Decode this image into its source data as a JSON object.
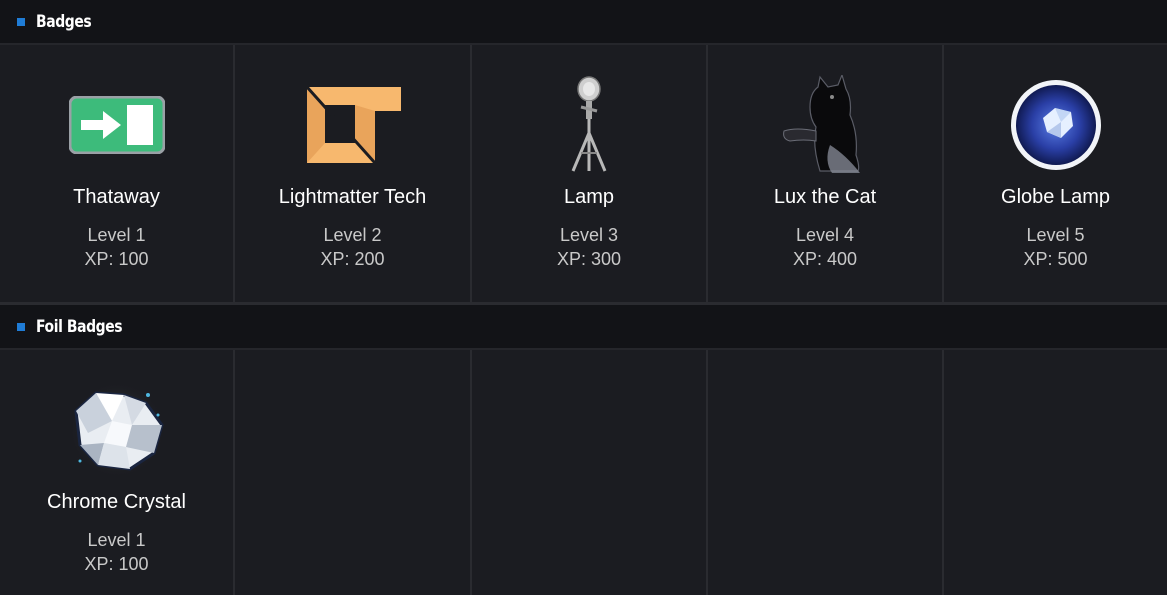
{
  "sections": {
    "badges": {
      "title": "Badges",
      "items": [
        {
          "name": "Thataway",
          "level": "Level 1",
          "xp": "XP: 100",
          "icon": "exit-sign-icon"
        },
        {
          "name": "Lightmatter Tech",
          "level": "Level 2",
          "xp": "XP: 200",
          "icon": "lightmatter-logo-icon"
        },
        {
          "name": "Lamp",
          "level": "Level 3",
          "xp": "XP: 300",
          "icon": "tripod-lamp-icon"
        },
        {
          "name": "Lux the Cat",
          "level": "Level 4",
          "xp": "XP: 400",
          "icon": "cat-icon"
        },
        {
          "name": "Globe Lamp",
          "level": "Level 5",
          "xp": "XP: 500",
          "icon": "globe-lamp-icon"
        }
      ]
    },
    "foil": {
      "title": "Foil Badges",
      "items": [
        {
          "name": "Chrome Crystal",
          "level": "Level 1",
          "xp": "XP: 100",
          "icon": "chrome-crystal-icon"
        }
      ]
    }
  },
  "colors": {
    "accent": "#1f7cd6",
    "background": "#1b1c21",
    "header_bg": "#121317"
  }
}
